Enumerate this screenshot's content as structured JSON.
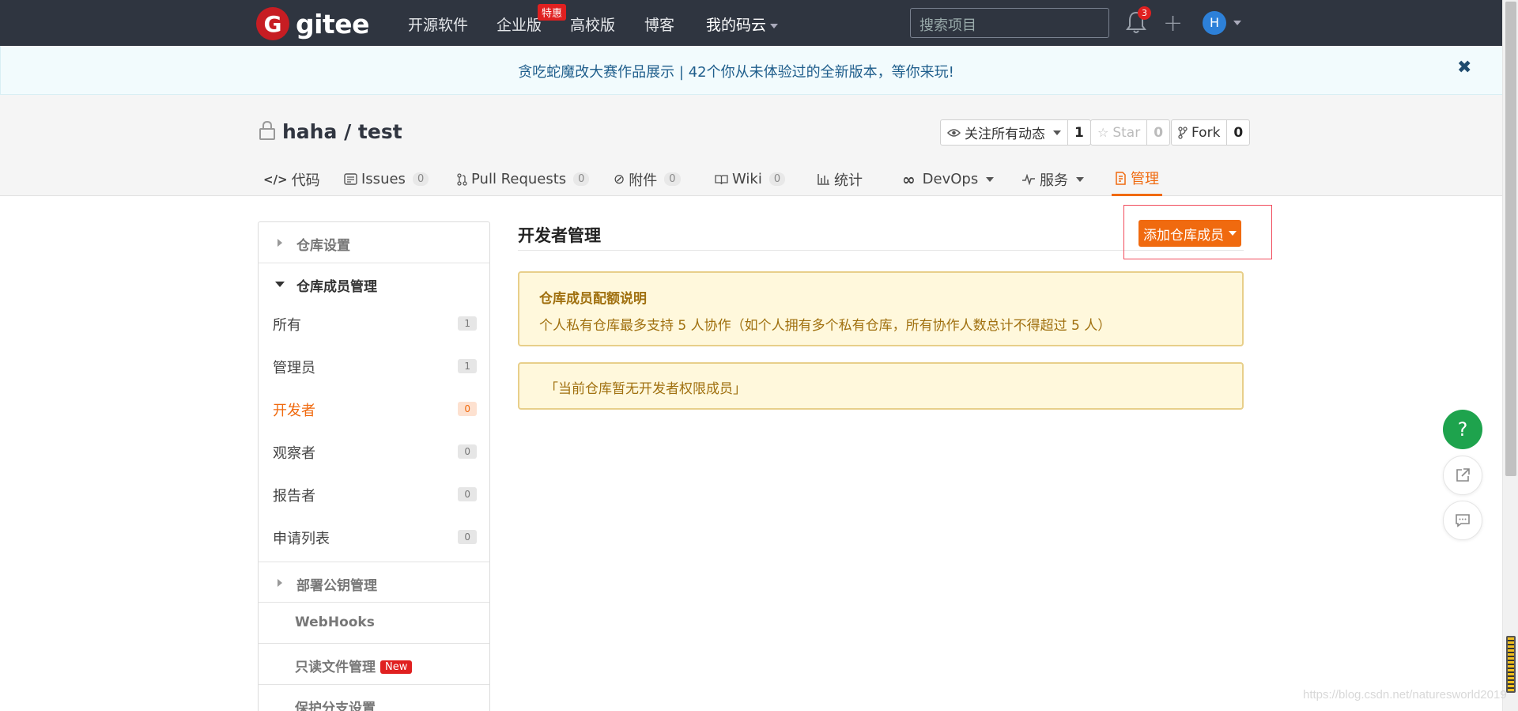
{
  "brand": {
    "logo_letter": "G",
    "name": "gitee"
  },
  "topnav": {
    "items": [
      "开源软件",
      "企业版",
      "高校版",
      "博客",
      "我的码云"
    ],
    "enterprise_badge": "特惠",
    "search_placeholder": "搜索项目",
    "notification_count": "3",
    "avatar_initial": "H"
  },
  "banner": {
    "text": "贪吃蛇魔改大赛作品展示 | 42个你从未体验过的全新版本，等你来玩!",
    "close": "✖"
  },
  "repo": {
    "owner": "haha",
    "separator": "/",
    "name": "test",
    "watch_label": "关注所有动态",
    "watch_count": "1",
    "star_label": "Star",
    "star_count": "0",
    "fork_label": "Fork",
    "fork_count": "0"
  },
  "tabs": [
    {
      "label": "代码"
    },
    {
      "label": "Issues",
      "count": "0"
    },
    {
      "label": "Pull Requests",
      "count": "0"
    },
    {
      "label": "附件",
      "count": "0"
    },
    {
      "label": "Wiki",
      "count": "0"
    },
    {
      "label": "统计"
    },
    {
      "label": "DevOps"
    },
    {
      "label": "服务"
    },
    {
      "label": "管理",
      "active": true
    }
  ],
  "sidebar": {
    "repo_settings": "仓库设置",
    "members_section": "仓库成员管理",
    "members": [
      {
        "label": "所有",
        "count": "1"
      },
      {
        "label": "管理员",
        "count": "1"
      },
      {
        "label": "开发者",
        "count": "0",
        "active": true
      },
      {
        "label": "观察者",
        "count": "0"
      },
      {
        "label": "报告者",
        "count": "0"
      },
      {
        "label": "申请列表",
        "count": "0"
      }
    ],
    "deploy_keys": "部署公钥管理",
    "webhooks": "WebHooks",
    "readonly_files": "只读文件管理",
    "new_badge": "New",
    "protected_branches": "保护分支设置"
  },
  "main": {
    "title": "开发者管理",
    "add_button": "添加仓库成员",
    "quota_title": "仓库成员配额说明",
    "quota_body": "个人私有仓库最多支持 5 人协作（如个人拥有多个私有仓库，所有协作人数总计不得超过 5 人）",
    "empty_notice": "「当前仓库暂无开发者权限成员」"
  },
  "fab": {
    "help": "?"
  },
  "watermark": "https://blog.csdn.net/naturesworld2019",
  "colors": {
    "accent": "#f06a0f",
    "navbar": "#2f3540",
    "brand": "#c71d23",
    "help": "#1ea34d"
  }
}
